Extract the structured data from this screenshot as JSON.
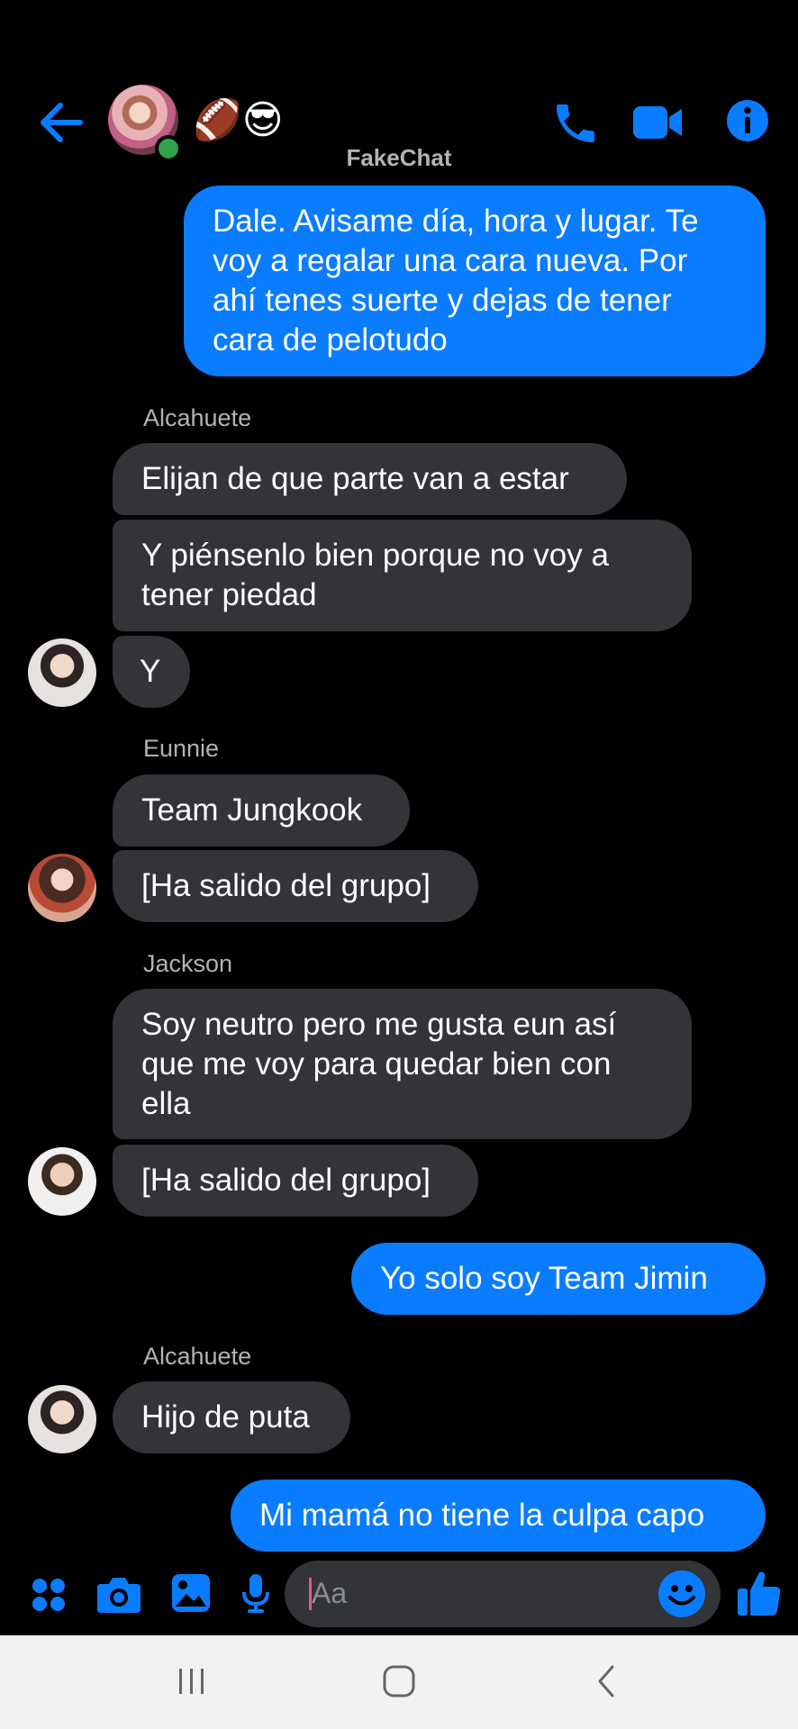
{
  "header": {
    "title_emojis": "🏈😎",
    "chat_name": "FakeChat",
    "accent": "#0a7cff"
  },
  "messages": [
    {
      "type": "out",
      "text": "Dale. Avisame día, hora y lugar. Te\nvoy a regalar una cara nueva. Por\nahí tenes suerte y dejas de tener\ncara de pelotudo"
    },
    {
      "type": "sender",
      "text": "Alcahuete"
    },
    {
      "type": "in",
      "text": "Elijan de que parte van a estar"
    },
    {
      "type": "in",
      "text": "Y piénsenlo bien porque no voy a\ntener piedad"
    },
    {
      "type": "in",
      "text": "Y"
    },
    {
      "type": "sender",
      "text": "Eunnie"
    },
    {
      "type": "in",
      "text": "Team Jungkook"
    },
    {
      "type": "in",
      "text": "[Ha salido del grupo]"
    },
    {
      "type": "sender",
      "text": "Jackson"
    },
    {
      "type": "in",
      "text": "Soy neutro pero me gusta eun así\nque me voy para quedar bien con\nella"
    },
    {
      "type": "in",
      "text": "[Ha salido del grupo]"
    },
    {
      "type": "out",
      "text": "Yo solo soy Team Jimin"
    },
    {
      "type": "sender",
      "text": "Alcahuete"
    },
    {
      "type": "in",
      "text": "Hijo de puta"
    },
    {
      "type": "out",
      "text": "Mi mamá no tiene la culpa capo"
    }
  ],
  "composer": {
    "placeholder": "Aa"
  }
}
